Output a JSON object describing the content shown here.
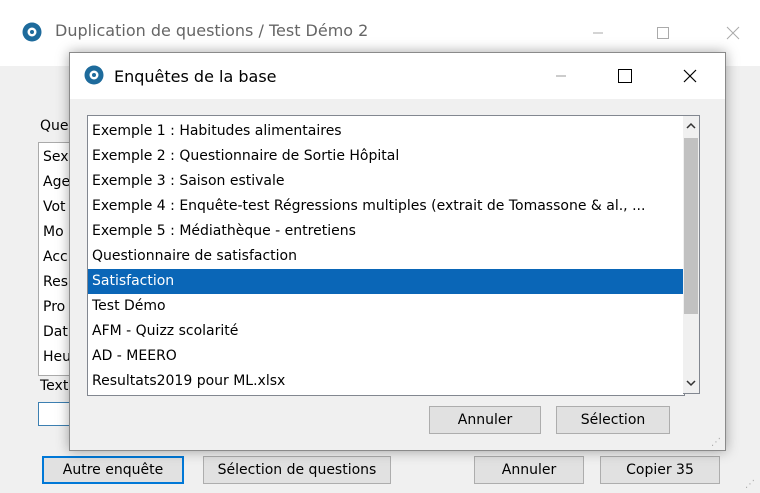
{
  "back_window": {
    "title": "Duplication de questions / Test Démo 2",
    "questions_label": "Que",
    "list_items": [
      "Sex",
      "Age",
      "Vot",
      "Mo",
      "Acc",
      "Res",
      "Pro",
      "Dat",
      "Heu"
    ],
    "text_label": "Text",
    "buttons": {
      "autre": "Autre enquête",
      "selection": "Sélection de questions",
      "annuler": "Annuler",
      "copier": "Copier 35"
    }
  },
  "dialog": {
    "title": "Enquêtes de la base",
    "items": [
      "Exemple 1 : Habitudes alimentaires",
      "Exemple 2 : Questionnaire de Sortie  Hôpital",
      "Exemple 3 : Saison estivale",
      "Exemple 4 : Enquête-test Régressions multiples (extrait de Tomassone & al., ...",
      "Exemple 5 : Médiathèque - entretiens",
      "Questionnaire de satisfaction",
      "Satisfaction",
      "Test Démo",
      "AFM - Quizz scolarité",
      "AD - MEERO",
      "Resultats2019 pour ML.xlsx"
    ],
    "selected_index": 6,
    "buttons": {
      "annuler": "Annuler",
      "selection": "Sélection"
    }
  },
  "colors": {
    "selection": "#0a66b7",
    "app_icon": "#1e6b9c"
  },
  "icons": [
    "app-icon",
    "minimize-icon",
    "maximize-icon",
    "close-icon",
    "scroll-up-icon",
    "scroll-down-icon",
    "resize-grip-icon"
  ]
}
